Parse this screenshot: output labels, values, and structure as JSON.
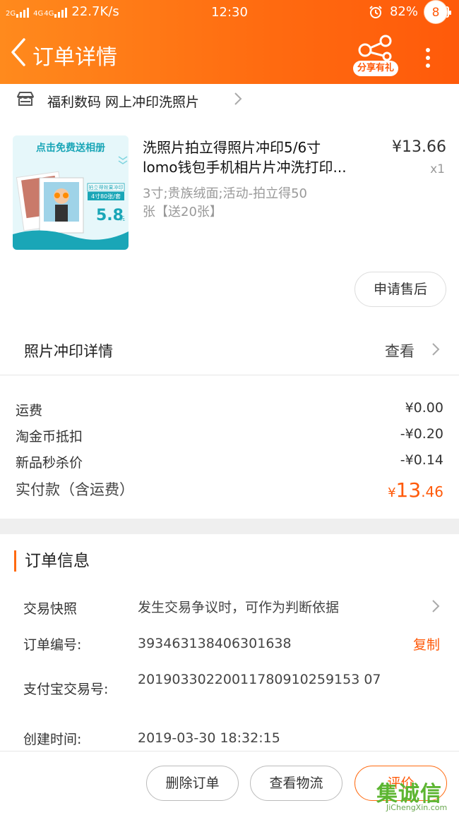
{
  "status_bar": {
    "network_1": "2G",
    "network_2": "4G",
    "network_3": "4G",
    "speed": "22.7K/s",
    "time": "12:30",
    "battery": "82%",
    "battery_level": 0.82
  },
  "header": {
    "title": "订单详情",
    "share_label": "分享有礼",
    "badge_count": "8"
  },
  "shop": {
    "name": "福利数码 网上冲印洗照片"
  },
  "product": {
    "title_line1": "洗照片拍立得照片冲印5/6寸",
    "title_line2": "lomo钱包手机相片片冲洗打印...",
    "price": "¥13.66",
    "quantity": "x1",
    "sku_line1": "3寸;贵族绒面;活动-拍立得50",
    "sku_line2": "张【送20张】",
    "after_sale_label": "申请售后",
    "thumb_text_top": "点击免费送相册",
    "thumb_text_tag1": "拍立得效果冲印",
    "thumb_text_tag2": "4寸80张/套",
    "thumb_price": "5.8",
    "thumb_unit": "元"
  },
  "photo_detail": {
    "label": "照片冲印详情",
    "view_label": "查看"
  },
  "fees": [
    {
      "label": "运费",
      "value": "¥0.00"
    },
    {
      "label": "淘金币抵扣",
      "value": "-¥0.20"
    },
    {
      "label": "新品秒杀价",
      "value": "-¥0.14"
    }
  ],
  "total": {
    "label": "实付款（含运费）",
    "yen": "¥",
    "integer": "13",
    "decimal": ".46"
  },
  "order_info": {
    "title": "订单信息",
    "snapshot_label": "交易快照",
    "snapshot_value": "发生交易争议时，可作为判断依据",
    "order_no_label": "订单编号:",
    "order_no_value": "393463138406301638",
    "copy_label": "复制",
    "alipay_label": "支付宝交易号:",
    "alipay_value": "20190330220011780910259153 07",
    "created_label": "创建时间:",
    "created_value": "2019-03-30 18:32:15"
  },
  "actions": {
    "delete_label": "删除订单",
    "logistics_label": "查看物流",
    "review_label": "评价"
  },
  "watermark": {
    "mark": "集诚信",
    "url": "JiChengXin.com"
  },
  "colors": {
    "accent": "#ff5a0a",
    "header_start": "#ff8a1d",
    "header_end": "#ff5a0a"
  }
}
